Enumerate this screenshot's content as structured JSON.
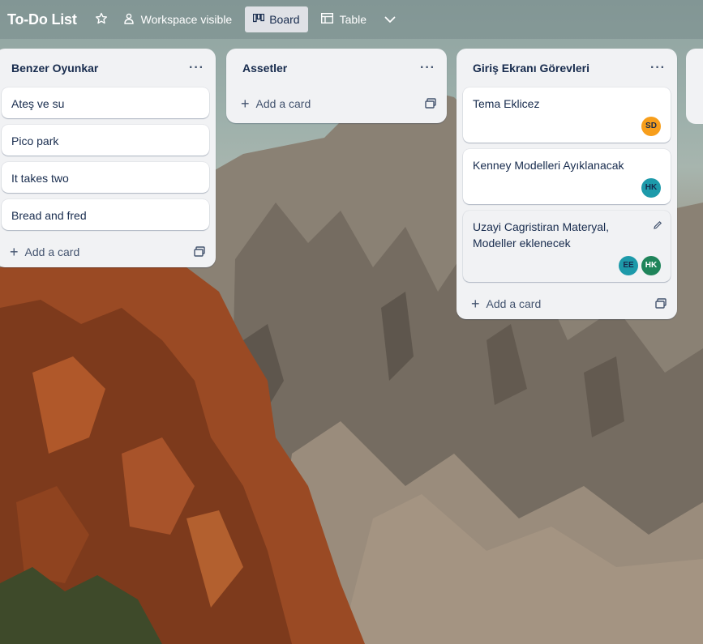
{
  "board": {
    "title": "To-Do List",
    "visibility_label": "Workspace visible",
    "views": [
      "Board",
      "Table"
    ],
    "active_view": "Board"
  },
  "icons": {
    "star": "star-icon",
    "visibility": "people-icon",
    "board": "board-icon",
    "table": "table-icon",
    "more": "chevron-down-icon",
    "add": "plus-icon",
    "template": "template-icon",
    "menu": "ellipsis-icon",
    "edit": "pencil-icon"
  },
  "lists": [
    {
      "title": "Benzer Oyunkar",
      "cards": [
        {
          "title": "Ateş ve su"
        },
        {
          "title": "Pico park"
        },
        {
          "title": "It takes two"
        },
        {
          "title": "Bread and fred"
        }
      ],
      "add_label": "Add a card"
    },
    {
      "title": "Assetler",
      "cards": [],
      "add_label": "Add a card"
    },
    {
      "title": "Giriş Ekranı Görevleri",
      "cards": [
        {
          "title": "Tema Eklicez",
          "members": [
            {
              "initials": "SD",
              "color": "#f79e1b"
            }
          ]
        },
        {
          "title": "Kenney Modelleri Ayıklanacak",
          "members": [
            {
              "initials": "HK",
              "color": "#1d9aaa"
            }
          ]
        },
        {
          "title": "Uzayi Cagristiran Materyal, Modeller eklenecek",
          "members": [
            {
              "initials": "EE",
              "color": "#1d9aaa"
            },
            {
              "initials": "HK",
              "color": "#1f845a"
            }
          ]
        }
      ],
      "add_label": "Add a card"
    }
  ],
  "menu_glyph": "···",
  "colors": {
    "list_bg": "#f1f2f4",
    "card_bg": "#ffffff",
    "text": "#172b4d",
    "header_bg": "#7c8f8e",
    "active_view_bg": "#dfe1e6"
  }
}
